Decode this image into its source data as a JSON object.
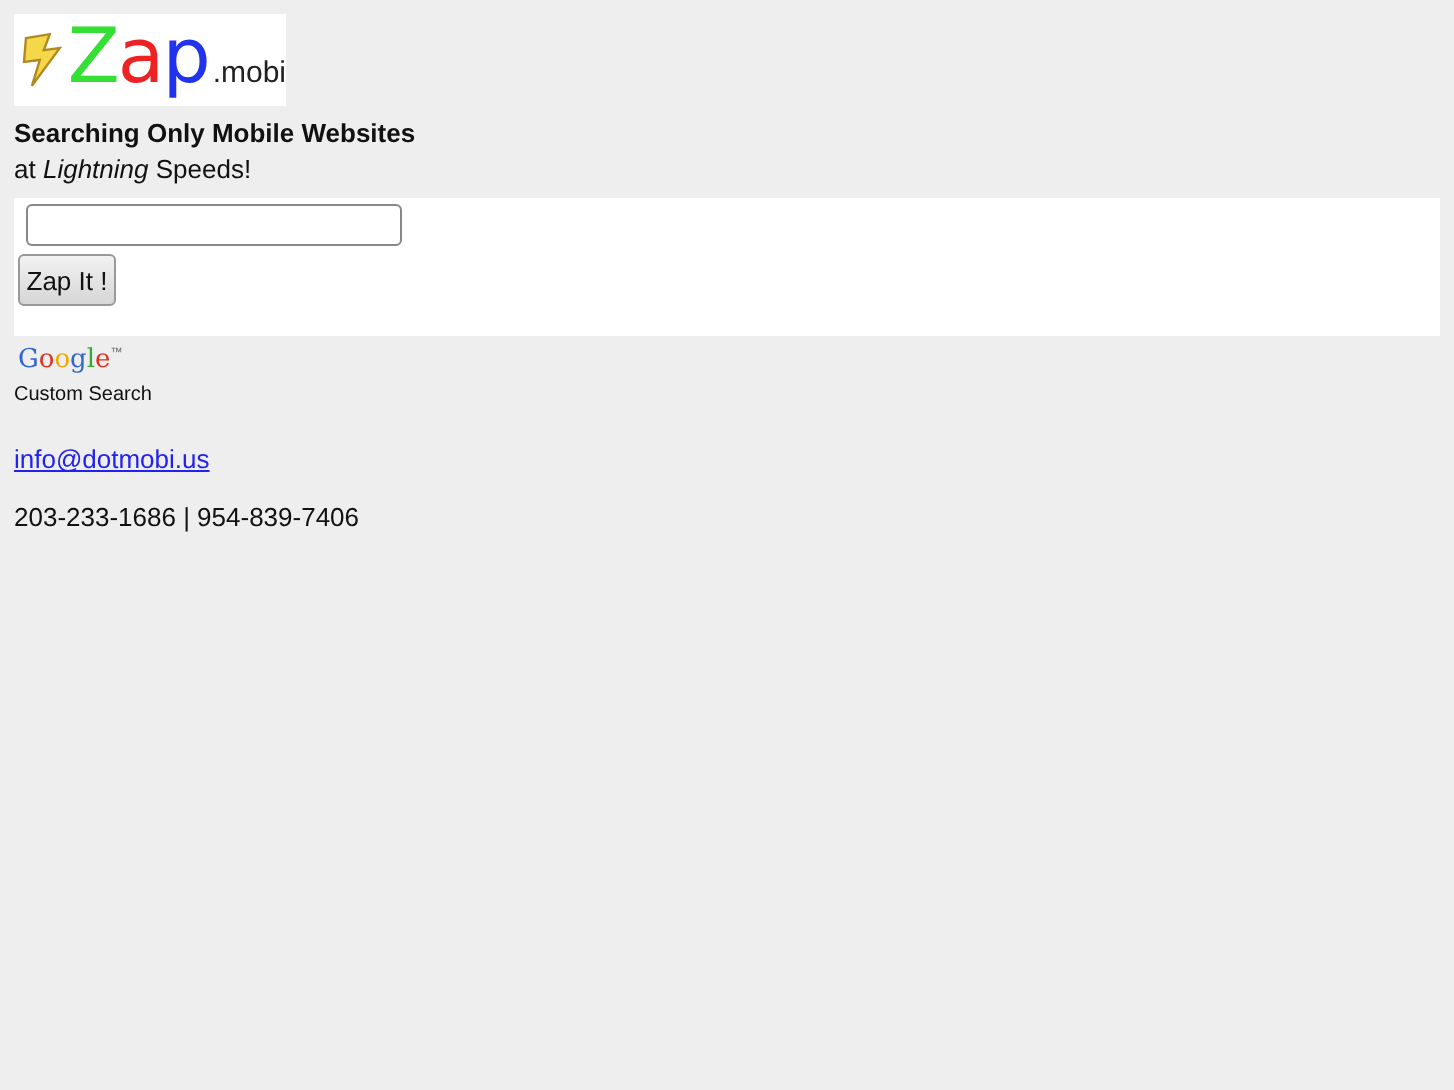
{
  "logo": {
    "letters": [
      {
        "char": "Z",
        "color": "#33e033"
      },
      {
        "char": "a",
        "color": "#ee2222"
      },
      {
        "char": "p",
        "color": "#2233ee"
      }
    ],
    "suffix": ".mobi"
  },
  "heading": "Searching Only Mobile Websites",
  "tagline": "at *Lightning* Speeds!",
  "search": {
    "button": "Zap It !"
  },
  "google": {
    "letters": [
      {
        "char": "G",
        "color": "#3366cc"
      },
      {
        "char": "o",
        "color": "#dd3322"
      },
      {
        "char": "o",
        "color": "#eeaa00"
      },
      {
        "char": "g",
        "color": "#3366cc"
      },
      {
        "char": "l",
        "color": "#33aa33"
      },
      {
        "char": "e",
        "color": "#dd3322"
      }
    ],
    "mark": "™",
    "caption": "Custom Search"
  },
  "email": "info@dotmobi.us",
  "phone": "203-233-1686 | 954-839-7406"
}
